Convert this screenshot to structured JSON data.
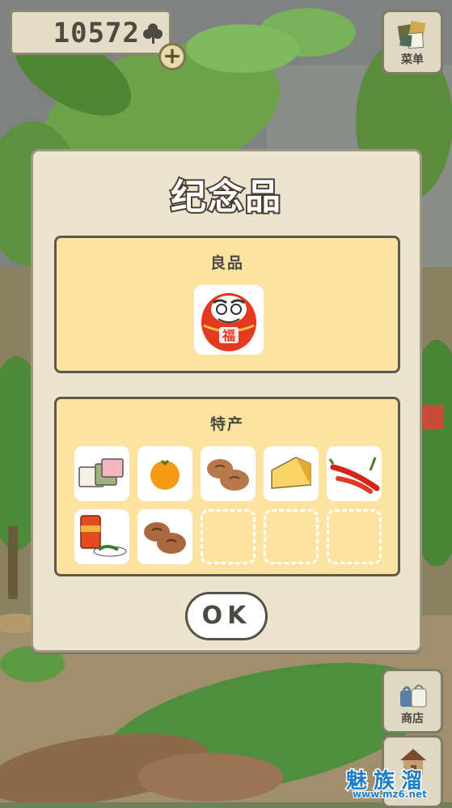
{
  "hud": {
    "clover_count": "10572",
    "clover_icon": "clover-icon",
    "add_icon": "plus-icon",
    "add_label": "+"
  },
  "side_menu": {
    "menu_label": "菜单",
    "shop_label": "商店",
    "home_icon": "house-icon"
  },
  "dialog": {
    "title": "纪念品",
    "good_items_section": {
      "title": "良品",
      "items": [
        {
          "name": "daruma-doll",
          "label": "福"
        }
      ]
    },
    "specialties_section": {
      "title": "特产",
      "items": [
        {
          "name": "mochi-sweets"
        },
        {
          "name": "mandarin-orange"
        },
        {
          "name": "steamed-buns"
        },
        {
          "name": "cheese-wedge"
        },
        {
          "name": "red-peppers"
        },
        {
          "name": "canned-tea-with-leaves"
        },
        {
          "name": "manju-buns"
        },
        {
          "name": "empty"
        },
        {
          "name": "empty"
        },
        {
          "name": "empty"
        }
      ]
    },
    "ok_label": "OK"
  },
  "watermark": {
    "text_cn": "魅族溜",
    "url": "www.mz6.net"
  }
}
